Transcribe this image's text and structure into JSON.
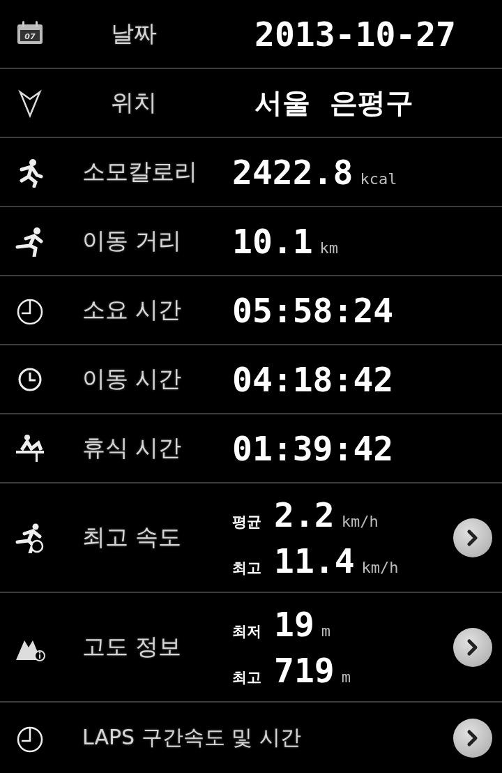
{
  "rows": [
    {
      "kind": "header",
      "label": "날짜",
      "value": "2013-10-27",
      "icon_label": "07"
    },
    {
      "kind": "place",
      "label": "위치",
      "value": "서울  은평구"
    },
    {
      "kind": "stat",
      "label": "소모칼로리",
      "value": "2422.8",
      "unit": "kcal"
    },
    {
      "kind": "stat",
      "label": "이동 거리",
      "value": "10.1",
      "unit": "km"
    },
    {
      "kind": "stat",
      "label": "소요 시간",
      "value": "05:58:24"
    },
    {
      "kind": "stat",
      "label": "이동 시간",
      "value": "04:18:42"
    },
    {
      "kind": "stat",
      "label": "휴식 시간",
      "value": "01:39:42"
    },
    {
      "kind": "pair",
      "label": "최고 속도",
      "entries": [
        {
          "label": "평균",
          "value": "2.2",
          "unit": "km/h"
        },
        {
          "label": "최고",
          "value": "11.4",
          "unit": "km/h"
        }
      ]
    },
    {
      "kind": "pair",
      "label": "고도 정보",
      "entries": [
        {
          "label": "최저",
          "value": "19",
          "unit": "m"
        },
        {
          "label": "최고",
          "value": "719",
          "unit": "m"
        }
      ]
    },
    {
      "kind": "link",
      "label": "LAPS 구간속도 및 시간"
    }
  ]
}
